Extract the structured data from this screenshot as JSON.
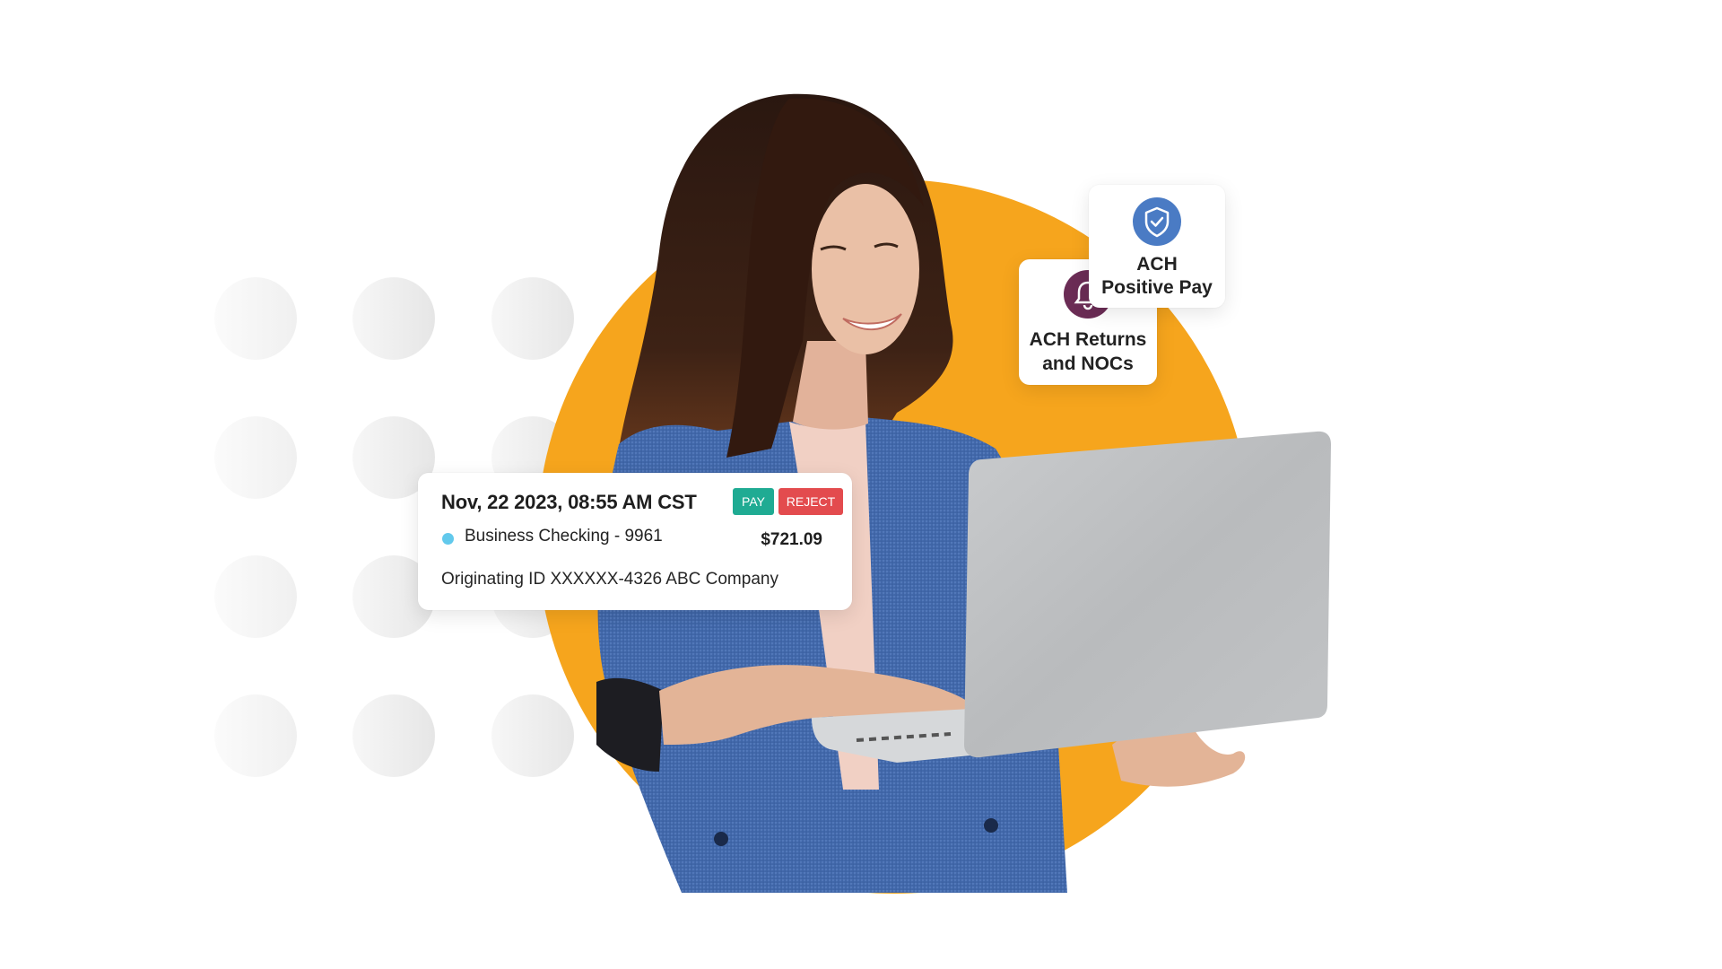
{
  "scene": {
    "accent_color": "#f6a51d",
    "transaction_card": {
      "datetime": "Nov, 22 2023, 08:55 AM CST",
      "pay_label": "PAY",
      "reject_label": "REJECT",
      "pay_color": "#1fab93",
      "reject_color": "#e34b4e",
      "account_name": "Business Checking - 9961",
      "account_dot_color": "#62c9ec",
      "amount": "$721.09",
      "originating": "Originating ID XXXXXX-4326 ABC Company"
    },
    "badges": [
      {
        "label_line1": "ACH Returns",
        "label_line2": "and NOCs",
        "icon": "bell-icon",
        "icon_color": "#6b2c55"
      },
      {
        "label_line1": "ACH",
        "label_line2": "Positive Pay",
        "icon": "shield-check-icon",
        "icon_color": "#4a7bc4"
      }
    ]
  }
}
